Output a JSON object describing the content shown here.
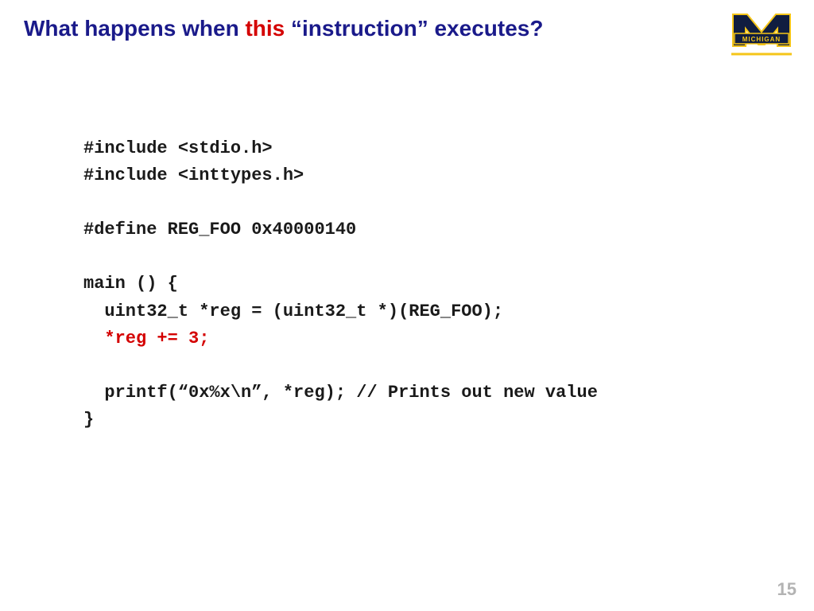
{
  "title": {
    "part1": "What happens when ",
    "highlight": "this",
    "part2": " “instruction” executes?"
  },
  "code": {
    "l1": "#include <stdio.h>",
    "l2": "#include <inttypes.h>",
    "l3": "",
    "l4": "#define REG_FOO 0x40000140",
    "l5": "",
    "l6": "main () {",
    "l7": "  uint32_t *reg = (uint32_t *)(REG_FOO);",
    "l8_indent": "  ",
    "l8_hl": "*reg += 3;",
    "l9": "",
    "l10": "  printf(“0x%x\\n”, *reg); // Prints out new value",
    "l11": "}"
  },
  "page_number": "15",
  "logo": {
    "label": "MICHIGAN",
    "colors": {
      "blue": "#101d40",
      "maize": "#f5c518"
    }
  }
}
